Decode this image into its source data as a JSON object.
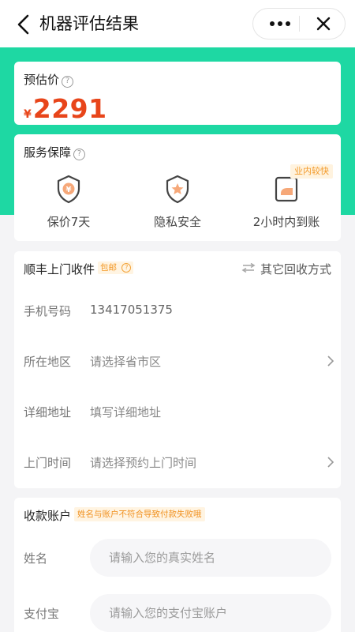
{
  "header": {
    "title": "机器评估结果",
    "more_glyph": "•••",
    "close_glyph": "✕"
  },
  "colors": {
    "brand_green": "#1ed8a3",
    "price_orange": "#e8451a",
    "badge_orange": "#f39a2a"
  },
  "price": {
    "label": "预估价",
    "currency": "¥",
    "value": "2291"
  },
  "service": {
    "title": "服务保障",
    "items": [
      {
        "icon": "yuan-shield-icon",
        "label": "保价7天"
      },
      {
        "icon": "star-shield-icon",
        "label": "隐私安全"
      },
      {
        "icon": "payment-card-icon",
        "label": "2小时内到账"
      }
    ],
    "badge": "业内较快"
  },
  "pickup": {
    "title": "顺丰上门收件",
    "free_badge": "包邮",
    "other_method": "其它回收方式",
    "fields": [
      {
        "label": "手机号码",
        "value": "13417051375",
        "has_arrow": false
      },
      {
        "label": "所在地区",
        "value": "请选择省市区",
        "has_arrow": true
      },
      {
        "label": "详细地址",
        "value": "填写详细地址",
        "has_arrow": false
      },
      {
        "label": "上门时间",
        "value": "请选择预约上门时间",
        "has_arrow": true
      }
    ]
  },
  "account": {
    "title": "收款账户",
    "warning": "姓名与账户不符合导致付款失败哦",
    "name_label": "姓名",
    "name_placeholder": "请输入您的真实姓名",
    "alipay_label": "支付宝",
    "alipay_placeholder": "请输入您的支付宝账户"
  }
}
